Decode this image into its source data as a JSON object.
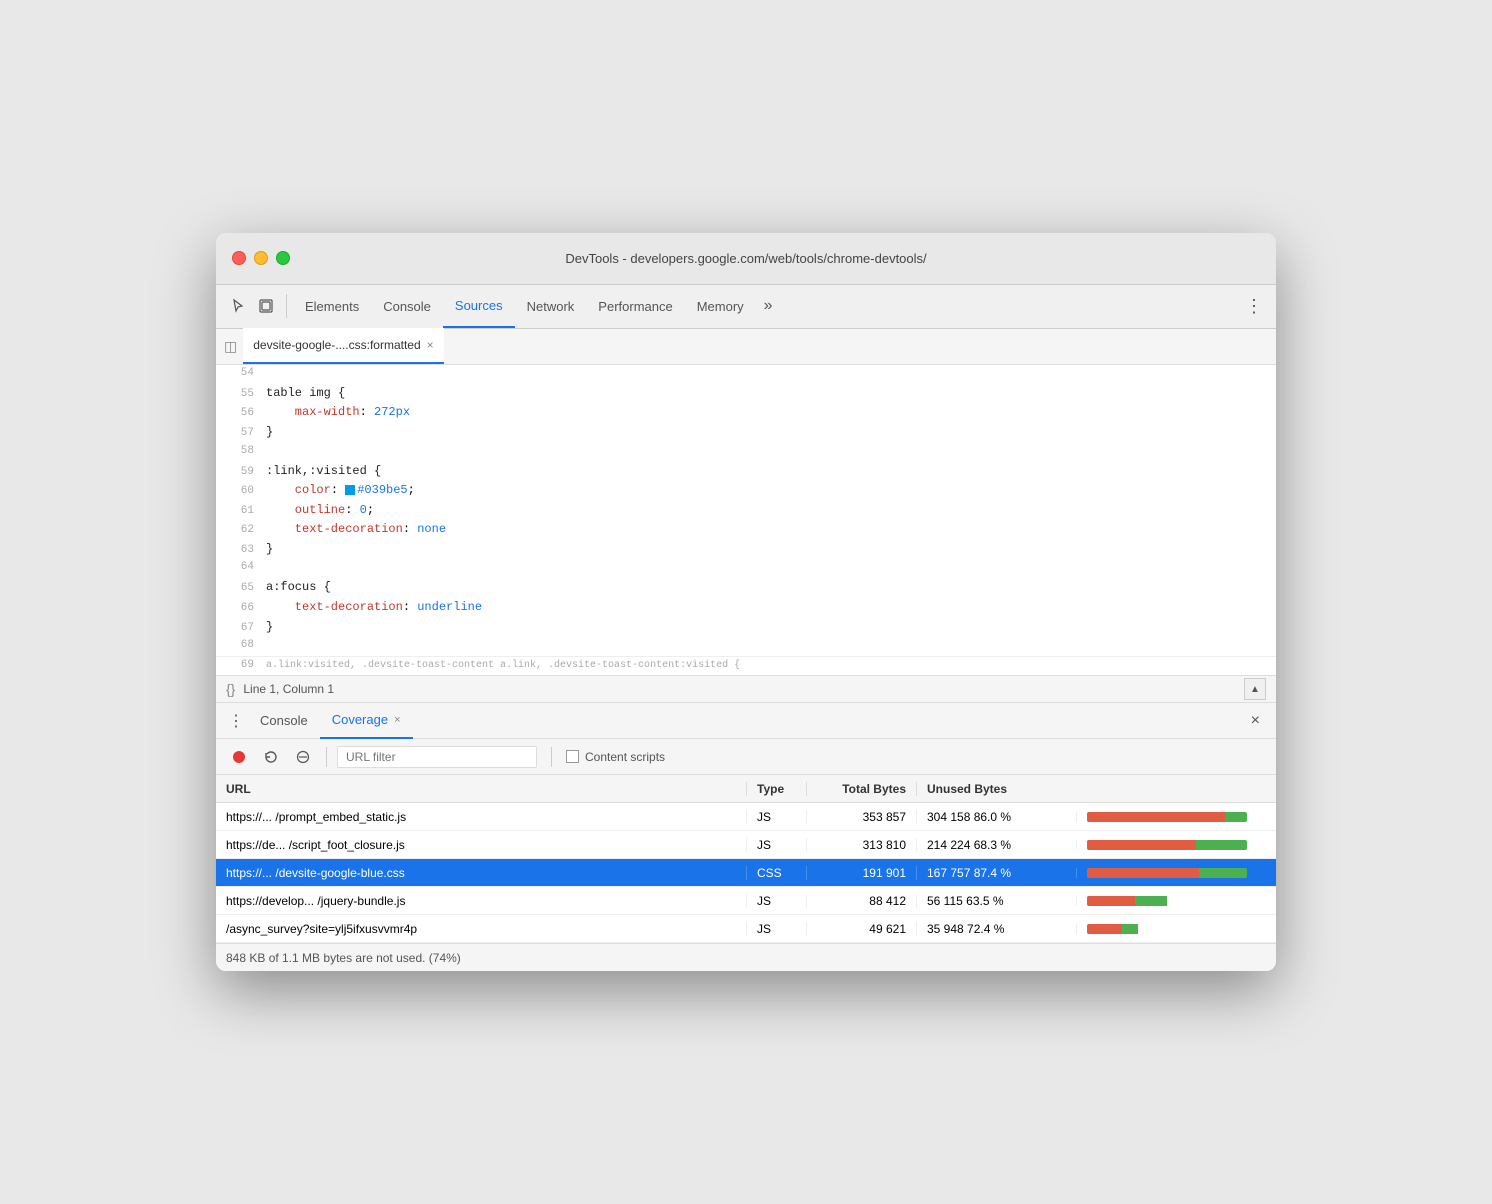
{
  "window": {
    "title": "DevTools - developers.google.com/web/tools/chrome-devtools/"
  },
  "tabs": {
    "items": [
      {
        "label": "Elements",
        "active": false
      },
      {
        "label": "Console",
        "active": false
      },
      {
        "label": "Sources",
        "active": true
      },
      {
        "label": "Network",
        "active": false
      },
      {
        "label": "Performance",
        "active": false
      },
      {
        "label": "Memory",
        "active": false
      }
    ],
    "more_label": "»",
    "menu_icon": "⋮"
  },
  "file_tab": {
    "name": "devsite-google-....css:formatted",
    "close": "×"
  },
  "code": {
    "lines": [
      {
        "num": "54",
        "marker": true,
        "content": ""
      },
      {
        "num": "55",
        "marker": false,
        "content": "table img {"
      },
      {
        "num": "56",
        "marker": true,
        "content": "    max-width: 272px",
        "has_prop": true,
        "prop": "max-width",
        "colon": ": ",
        "value": "272px",
        "value_color": "#1a73e8"
      },
      {
        "num": "57",
        "marker": false,
        "content": "}"
      },
      {
        "num": "58",
        "marker": false,
        "content": ""
      },
      {
        "num": "59",
        "marker": false,
        "content": ":link,:visited {"
      },
      {
        "num": "60",
        "marker": true,
        "content": "    color: #039be5;",
        "has_color": true,
        "prop": "color",
        "color_hex": "#039be5",
        "color_swatch": "#039be5"
      },
      {
        "num": "61",
        "marker": true,
        "content": "    outline: 0;",
        "prop": "outline",
        "value": "0"
      },
      {
        "num": "62",
        "marker": true,
        "content": "    text-decoration: none"
      },
      {
        "num": "63",
        "marker": false,
        "content": "}"
      },
      {
        "num": "64",
        "marker": false,
        "content": ""
      },
      {
        "num": "65",
        "marker": false,
        "content": "a:focus {"
      },
      {
        "num": "66",
        "marker": true,
        "content": "    text-decoration: underline"
      },
      {
        "num": "67",
        "marker": false,
        "content": "}"
      },
      {
        "num": "68",
        "marker": false,
        "content": ""
      }
    ]
  },
  "status_bar": {
    "icon": "{}",
    "text": "Line 1, Column 1"
  },
  "bottom_panel": {
    "tabs": [
      {
        "label": "Console",
        "active": false,
        "closeable": false
      },
      {
        "label": "Coverage",
        "active": true,
        "closeable": true
      }
    ],
    "close_icon": "×"
  },
  "coverage": {
    "toolbar": {
      "record_title": "Start instrumenting coverage and reload page",
      "reload_title": "Reload",
      "clear_title": "Clear all",
      "url_filter_placeholder": "URL filter",
      "content_scripts_label": "Content scripts"
    },
    "table": {
      "headers": [
        "URL",
        "Type",
        "Total Bytes",
        "Unused Bytes",
        ""
      ],
      "rows": [
        {
          "url": "https://... /prompt_embed_static.js",
          "type": "JS",
          "total": "353 857",
          "unused": "304 158 86.0 %",
          "unused_pct": 86.0,
          "selected": false
        },
        {
          "url": "https://de... /script_foot_closure.js",
          "type": "JS",
          "total": "313 810",
          "unused": "214 224 68.3 %",
          "unused_pct": 68.3,
          "selected": false
        },
        {
          "url": "https://... /devsite-google-blue.css",
          "type": "CSS",
          "total": "191 901",
          "unused": "167 757 87.4 %",
          "unused_pct": 87.4,
          "selected": true
        },
        {
          "url": "https://develop... /jquery-bundle.js",
          "type": "JS",
          "total": "88 412",
          "unused": "56 115 63.5 %",
          "unused_pct": 63.5,
          "selected": false
        },
        {
          "url": "/async_survey?site=ylj5ifxusvvmr4p",
          "type": "JS",
          "total": "49 621",
          "unused": "35 948 72.4 %",
          "unused_pct": 72.4,
          "selected": false
        }
      ]
    },
    "summary": "848 KB of 1.1 MB bytes are not used. (74%)"
  },
  "icons": {
    "cursor": "↖",
    "layers": "⧉",
    "more_tabs": "»",
    "file_icon": "◫",
    "curly": "{}",
    "scroll_up": "▲",
    "reload": "↻",
    "clear": "⊘",
    "dots": "⋮",
    "close": "×"
  }
}
